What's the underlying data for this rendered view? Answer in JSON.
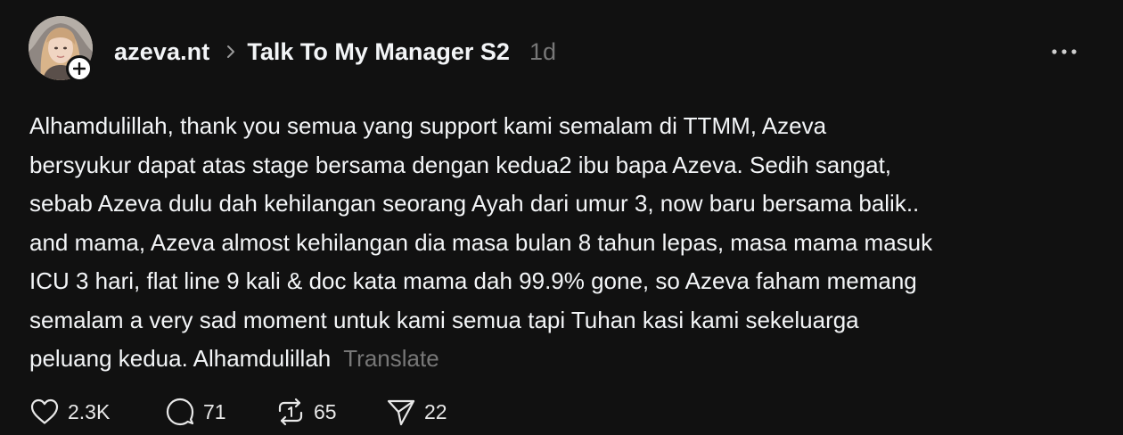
{
  "post": {
    "author": {
      "username": "azeva.nt",
      "avatar_icon": "profile-photo",
      "follow_icon": "plus-icon"
    },
    "community": "Talk To My Manager S2",
    "time_ago": "1d",
    "text_lines": [
      "Alhamdulillah, thank you semua yang support kami semalam di TTMM, Azeva",
      "bersyukur dapat atas stage bersama dengan kedua2 ibu bapa Azeva. Sedih sangat,",
      "sebab Azeva dulu dah kehilangan seorang Ayah dari umur 3, now baru bersama balik..",
      "and mama, Azeva almost kehilangan dia masa bulan 8 tahun lepas, masa mama masuk",
      "ICU 3 hari, flat line 9 kali & doc kata mama dah 99.9% gone, so Azeva faham memang",
      "semalam a very sad moment untuk kami semua tapi Tuhan kasi kami sekeluarga",
      "peluang kedua. Alhamdulillah"
    ],
    "translate_label": "Translate",
    "actions": {
      "likes": "2.3K",
      "replies": "71",
      "reposts": "65",
      "shares": "22"
    }
  },
  "colors": {
    "background": "#111111",
    "text": "#f3f5f7",
    "muted": "#777777"
  }
}
